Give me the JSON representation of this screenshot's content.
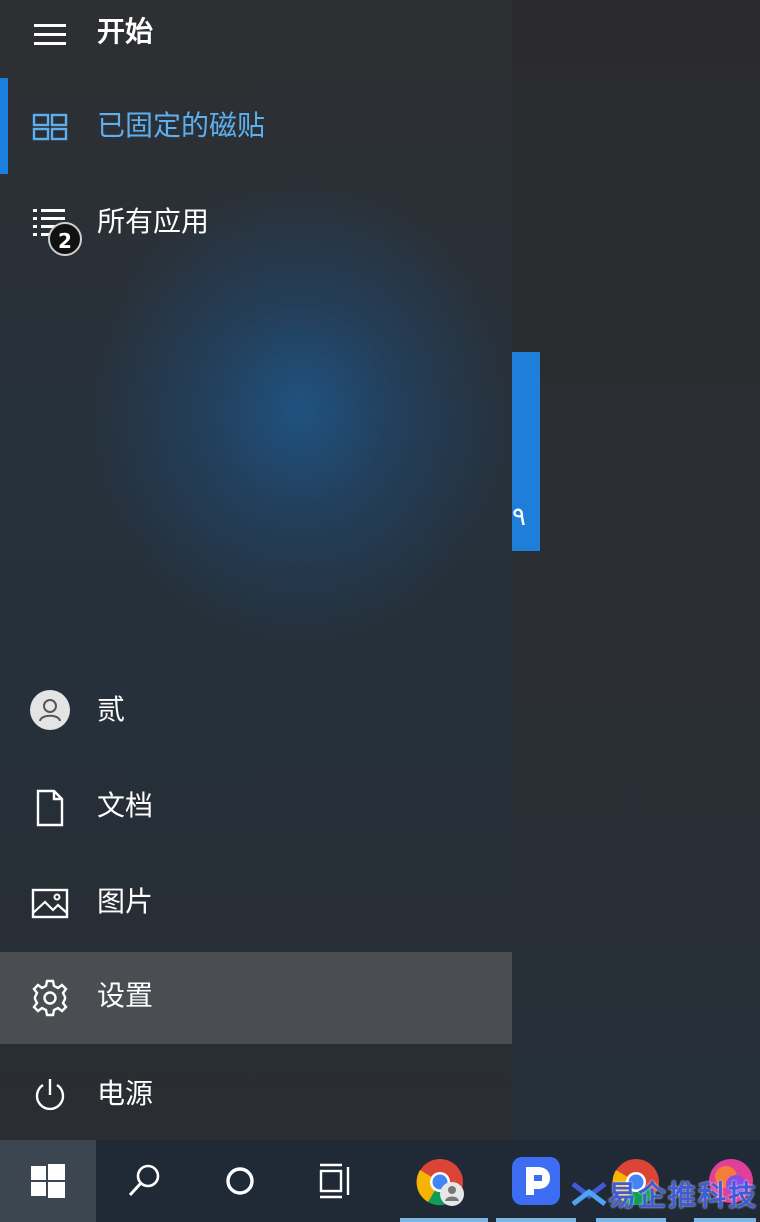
{
  "start_menu": {
    "title": "开始",
    "nav": {
      "pinned_tiles_label": "已固定的磁贴",
      "all_apps_label": "所有应用",
      "all_apps_badge": "2"
    },
    "bottom": {
      "user_label": "贰",
      "documents_label": "文档",
      "pictures_label": "图片",
      "settings_label": "设置",
      "power_label": "电源"
    }
  },
  "tile_fragment": {
    "glyph": "٩"
  },
  "taskbar": {
    "icons": [
      "windows-start-icon",
      "search-icon",
      "cortana-icon",
      "task-view-icon",
      "chrome-icon",
      "app-icon",
      "chrome-icon",
      "app-icon"
    ]
  },
  "watermark": {
    "text": "易企推科技"
  },
  "colors": {
    "accent": "#1a7fe0",
    "selected_text": "#5cb0f0",
    "settings_highlight": "#4a4d51",
    "taskbar": "#1f2a36"
  }
}
